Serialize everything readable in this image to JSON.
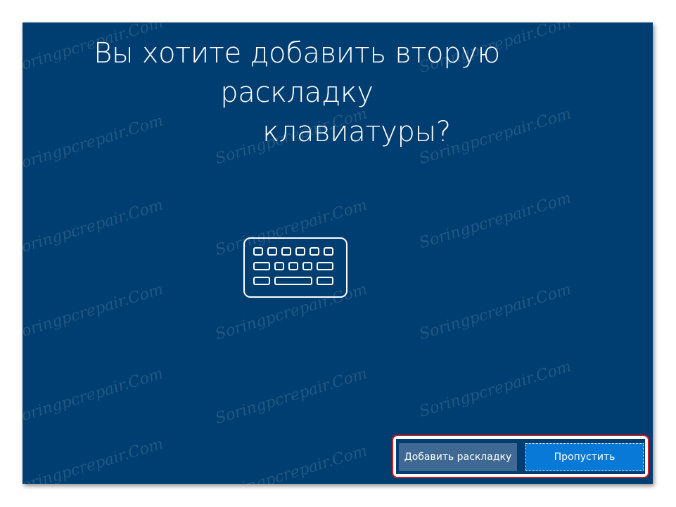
{
  "dialog": {
    "title_line1": "Вы хотите добавить вторую раскладку",
    "title_line2": "клавиатуры?",
    "icon": "keyboard-icon"
  },
  "buttons": {
    "add_layout": "Добавить раскладку",
    "skip": "Пропустить"
  },
  "watermark": {
    "text": "Soringpcrepair.Com"
  },
  "colors": {
    "background": "#003e71",
    "add_button": "#3f6992",
    "skip_button": "#0879d7",
    "highlight_border": "#d01c24"
  }
}
